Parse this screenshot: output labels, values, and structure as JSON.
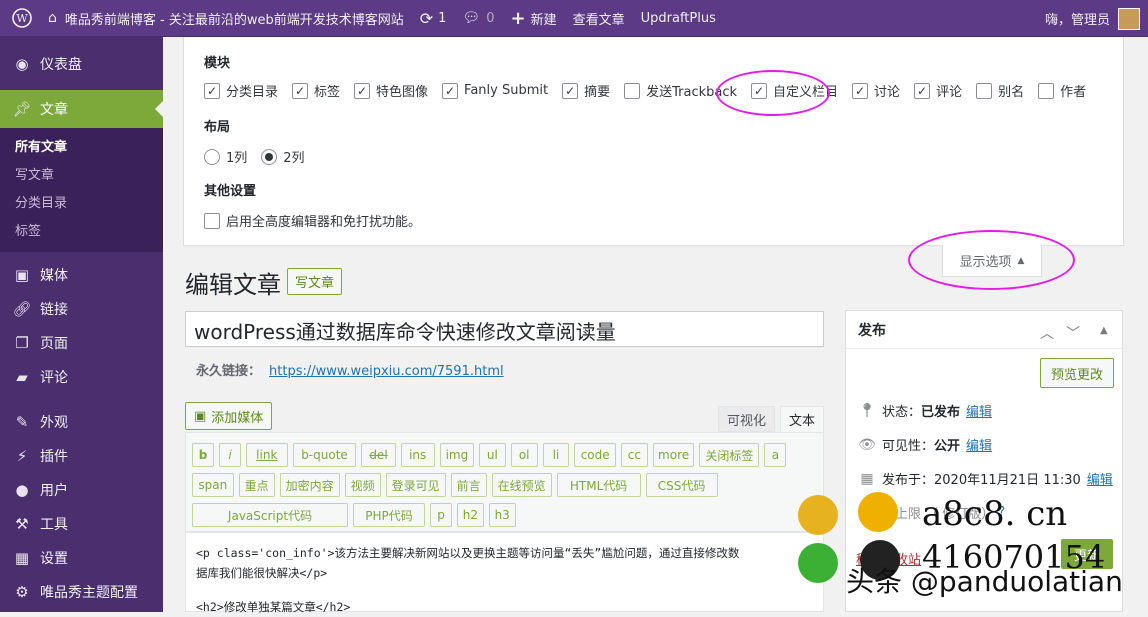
{
  "admin_bar": {
    "site_name": "唯品秀前端博客 - 关注最前沿的web前端开发技术博客网站",
    "updates_count": "1",
    "comments_count": "0",
    "new_label": "新建",
    "view_post": "查看文章",
    "plugin": "UpdraftPlus",
    "greeting": "嗨，管理员"
  },
  "sidebar": {
    "items": [
      {
        "label": "仪表盘",
        "icon": "dashboard-icon"
      },
      {
        "label": "文章",
        "icon": "pin-icon"
      },
      {
        "label": "媒体",
        "icon": "media-icon"
      },
      {
        "label": "链接",
        "icon": "link-icon"
      },
      {
        "label": "页面",
        "icon": "pages-icon"
      },
      {
        "label": "评论",
        "icon": "comments-icon"
      },
      {
        "label": "外观",
        "icon": "brush-icon"
      },
      {
        "label": "插件",
        "icon": "plugin-icon"
      },
      {
        "label": "用户",
        "icon": "user-icon"
      },
      {
        "label": "工具",
        "icon": "wrench-icon"
      },
      {
        "label": "设置",
        "icon": "settings-icon"
      },
      {
        "label": "唯品秀主题配置",
        "icon": "gear-icon"
      }
    ],
    "submenu": [
      "所有文章",
      "写文章",
      "分类目录",
      "标签"
    ]
  },
  "screen_options": {
    "modules_heading": "模块",
    "modules": [
      {
        "label": "分类目录",
        "checked": true
      },
      {
        "label": "标签",
        "checked": true
      },
      {
        "label": "特色图像",
        "checked": true
      },
      {
        "label": "Fanly Submit",
        "checked": true
      },
      {
        "label": "摘要",
        "checked": true
      },
      {
        "label": "发送Trackback",
        "checked": false
      },
      {
        "label": "自定义栏目",
        "checked": true
      },
      {
        "label": "讨论",
        "checked": true
      },
      {
        "label": "评论",
        "checked": true
      },
      {
        "label": "别名",
        "checked": false
      },
      {
        "label": "作者",
        "checked": false
      }
    ],
    "layout_heading": "布局",
    "layout_options": [
      "1列",
      "2列"
    ],
    "layout_selected": "2列",
    "other_heading": "其他设置",
    "other_option": "启用全高度编辑器和免打扰功能。",
    "toggle_label": "显示选项"
  },
  "editor": {
    "heading": "编辑文章",
    "write_button": "写文章",
    "post_title": "wordPress通过数据库命令快速修改文章阅读量",
    "permalink_label": "永久链接：",
    "permalink_url": "https://www.weipxiu.com/7591.html",
    "add_media": "添加媒体",
    "tab_visual": "可视化",
    "tab_text": "文本",
    "quicktags_row1": [
      "b",
      "i",
      "link",
      "b-quote",
      "del",
      "ins",
      "img",
      "ul",
      "ol",
      "li",
      "code",
      "cc",
      "more",
      "关闭标签",
      "a"
    ],
    "quicktags_row2": [
      "span",
      "重点",
      "加密内容",
      "视频",
      "登录可见",
      "前言",
      "在线预览",
      "HTML代码",
      "CSS代码"
    ],
    "quicktags_row3": [
      "JavaScript代码",
      "PHP代码",
      "p",
      "h2",
      "h3"
    ],
    "content_line1": "<p class='con_info'>该方法主要解决新网站以及更换主题等访问量“丢失”尴尬问题，通过直接修改数",
    "content_line2": "据库我们能很快解决</p>",
    "content_line3": "<h2>修改单独某篇文章</h2>"
  },
  "publish": {
    "title": "发布",
    "preview_button": "预览更改",
    "status_label": "状态：",
    "status_value": "已发布",
    "visibility_label": "可见性：",
    "visibility_value": "公开",
    "published_label": "发布于：",
    "published_value": "2020年11月21日 11:30",
    "edit_link": "编辑",
    "revisions_partial": "：上限 （ 修订版）",
    "trash": "移至回收站",
    "update": "更新"
  },
  "watermark": {
    "line1": "a8c8. cn",
    "line2": "头条 @panduolatian",
    "qq": "416070154"
  },
  "colors": {
    "admin_bar": "#5c3a85",
    "sidebar": "#4a2e6e",
    "accent": "#7da83a",
    "highlight": "#e21ee6"
  }
}
